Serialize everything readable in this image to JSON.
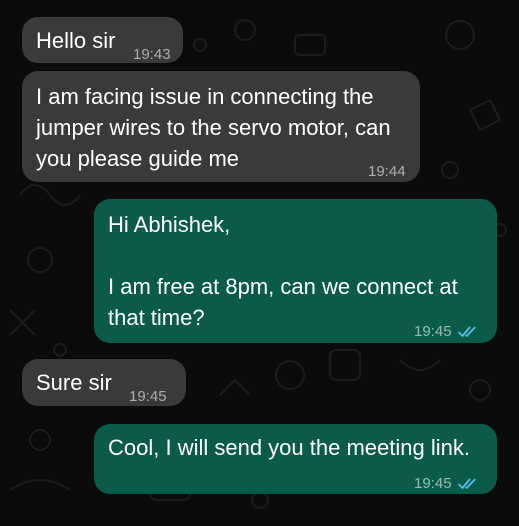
{
  "messages": [
    {
      "direction": "incoming",
      "text": "Hello sir",
      "time": "19:43"
    },
    {
      "direction": "incoming",
      "text": "I am facing issue in connecting the\njumper wires to the servo motor, can\nyou please guide me",
      "time": "19:44"
    },
    {
      "direction": "outgoing",
      "text": "Hi Abhishek,\n\nI am free at 8pm, can we connect at\nthat time?",
      "time": "19:45",
      "status": "read"
    },
    {
      "direction": "incoming",
      "text": "Sure sir",
      "time": "19:45"
    },
    {
      "direction": "outgoing",
      "text": "Cool, I will send you the meeting link.",
      "time": "19:45",
      "status": "read"
    }
  ],
  "colors": {
    "background": "#0b0b0b",
    "incoming_bubble": "#3a3a3c",
    "outgoing_bubble": "#0b5b4a",
    "read_tick": "#53bdeb"
  },
  "icons": {
    "read_receipt": "double-check-icon"
  }
}
